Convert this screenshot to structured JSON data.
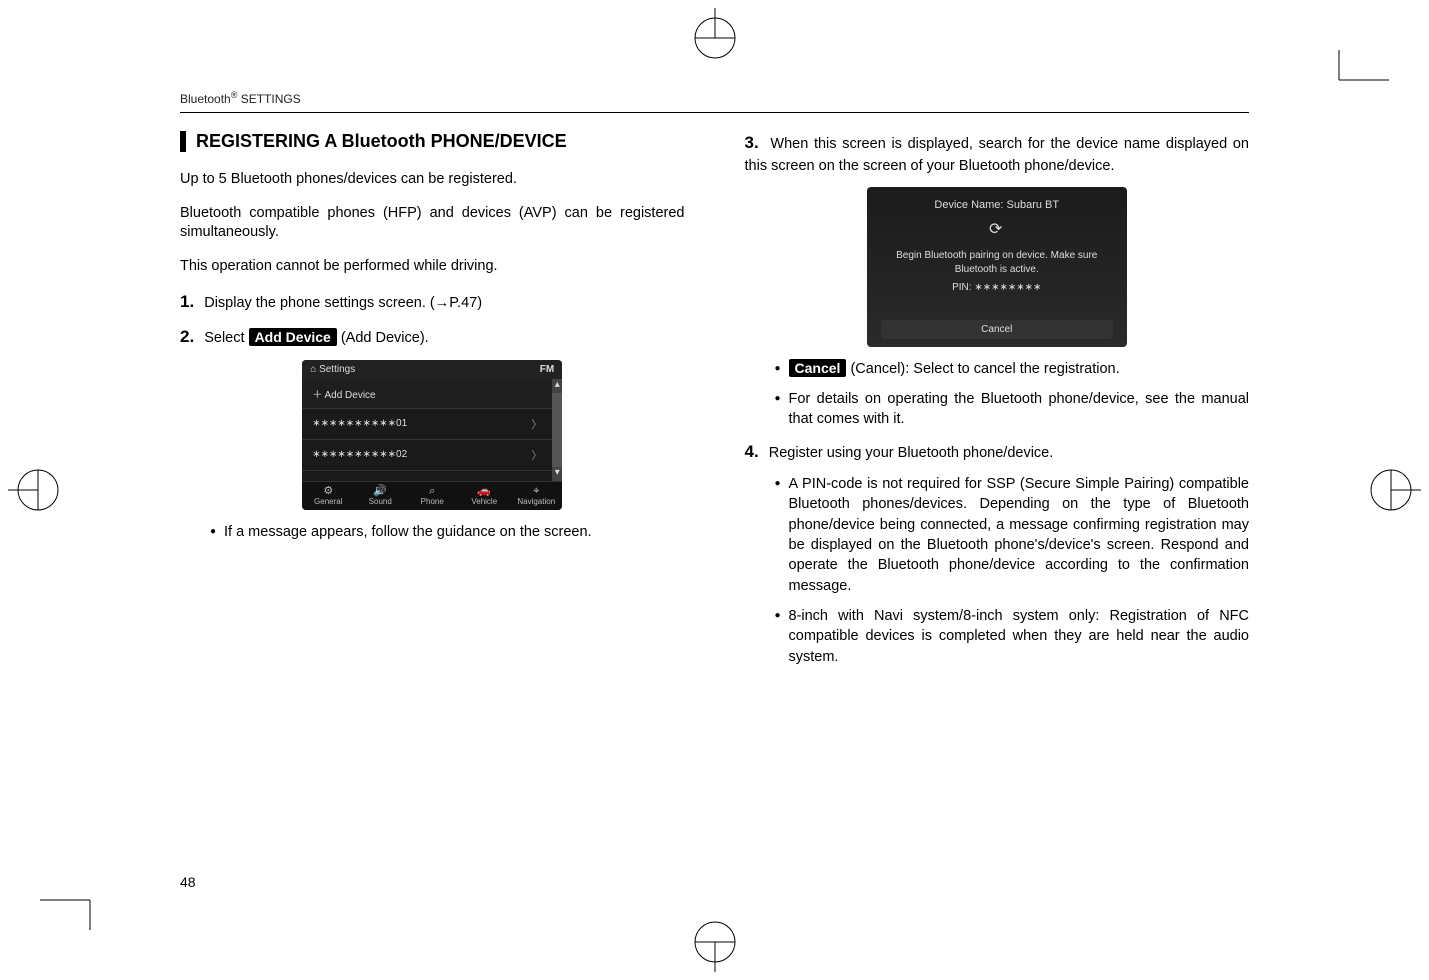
{
  "header": "Bluetooth® SETTINGS",
  "section_title": "REGISTERING A Bluetooth PHONE/DEVICE",
  "intro1": "Up to 5 Bluetooth phones/devices can be registered.",
  "intro2": "Bluetooth compatible phones (HFP) and devices (AVP) can be registered simultaneously.",
  "intro3": "This operation cannot be performed while driving.",
  "steps": {
    "s1": {
      "num": "1.",
      "text": "Display the phone settings screen. (→P.47)"
    },
    "s2": {
      "num": "2.",
      "prefix": "Select ",
      "chip": "Add Device",
      "suffix": " (Add Device)."
    },
    "s2_note": "If a message appears, follow the guidance on the screen.",
    "s3": {
      "num": "3.",
      "text": "When this screen is displayed, search for the device name displayed on this screen on the screen of your Bluetooth phone/device."
    },
    "s3_cancel_chip": "Cancel",
    "s3_cancel_text": " (Cancel): Select to cancel the registration.",
    "s3_detail": "For details on operating the Bluetooth phone/device, see the manual that comes with it.",
    "s4": {
      "num": "4.",
      "text": "Register using your Bluetooth phone/device."
    },
    "s4_b1": "A PIN-code is not required for SSP (Secure Simple Pairing) compatible Bluetooth phones/devices. Depending on the type of Bluetooth phone/device being connected, a message confirming registration may be displayed on the Bluetooth phone's/device's screen. Respond and operate the Bluetooth phone/device according to the confirmation message.",
    "s4_b2": "8-inch with Navi system/8-inch system only: Registration of NFC compatible devices is completed when they are held near the audio system."
  },
  "settings_mock": {
    "title": "Settings",
    "fm": "FM",
    "add": "Add Device",
    "row1": "∗∗∗∗∗∗∗∗∗∗01",
    "row2": "∗∗∗∗∗∗∗∗∗∗02",
    "tabs": [
      "General",
      "Sound",
      "Phone",
      "Vehicle",
      "Navigation"
    ],
    "tab_icons": [
      "⚙",
      "🔊",
      "⌕",
      "🚗",
      "⌖"
    ]
  },
  "pairing_mock": {
    "device_name": "Device Name: Subaru BT",
    "msg1": "Begin Bluetooth pairing on device. Make sure",
    "msg2": "Bluetooth is active.",
    "pin": "PIN: ∗∗∗∗∗∗∗∗",
    "cancel": "Cancel"
  },
  "page_number": "48"
}
